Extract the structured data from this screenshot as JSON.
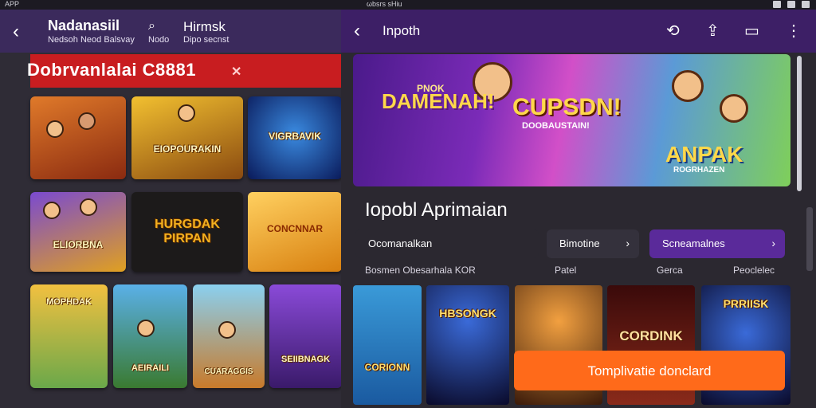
{
  "status": {
    "left_label": "APP",
    "mid_label": "ωbsrs sHiu"
  },
  "left": {
    "header": {
      "title": "Nadanasiil",
      "subtitle": "Nedsoh Neod Balsvay",
      "search_label": "Nodo",
      "tab": "Hirmsk",
      "tab_sub": "Dipo secnst"
    },
    "banner_text": "Dobrvanlalai C8881",
    "tiles": [
      {
        "cap": "",
        "bg": "#b84a1c"
      },
      {
        "cap": "EIOPOURAKIN",
        "bg": "#c88a1a"
      },
      {
        "cap": "VIGRBAVIK",
        "bg": "#1b3a8a"
      },
      {
        "cap": "ELIORBNA",
        "bg": "#e0a020"
      },
      {
        "cap": "HURGDAK PIRPAN",
        "bg": "#1c1a1a"
      },
      {
        "cap": "CONCNNAR",
        "bg": "#f2b030"
      },
      {
        "cap": "MOPHDAK",
        "bg": "#6aa84a"
      },
      {
        "cap": "AEIRAILI",
        "bg": "#3a8ad0"
      },
      {
        "cap": "CUARAGGIS",
        "bg": "#5ab0d8"
      },
      {
        "cap": "SEIIBNAGK",
        "bg": "#5a3aa0"
      }
    ]
  },
  "right": {
    "header": {
      "title": "Inpoth"
    },
    "banner": {
      "line1": "DAMENAH!",
      "line1_small": "PNOK",
      "line2": "CUPSDN!",
      "line2_small": "DOOBAUSTAIN!",
      "line3": "ANPAK",
      "line3_small": "ROGRHAZEN"
    },
    "section_title": "Iopobl Aprimaian",
    "pills": [
      {
        "label": "Ocomanalkan",
        "chev": ""
      },
      {
        "label": "Bimotine",
        "chev": "›"
      },
      {
        "label": "Scneamalnes",
        "chev": "›"
      }
    ],
    "subs": [
      "Bosmen Obesarhala KOR",
      "Patel",
      "Gerca",
      "Peoclelec"
    ],
    "games": [
      {
        "cap": "CORIONN",
        "bg": "#3a9ad8"
      },
      {
        "cap": "HBSONGK",
        "bg": "#1a1a40"
      },
      {
        "cap": "",
        "bg": "#c86a1a"
      },
      {
        "cap": "CORDINK",
        "bg": "#5a1a1a"
      },
      {
        "cap": "PRRIISK",
        "bg": "#1a2a5a"
      }
    ],
    "toast": "Tomplivatie donclard"
  },
  "colors": {
    "accent": "#3d1f66",
    "banner_red": "#c81d20",
    "toast": "#ff6a1a"
  }
}
